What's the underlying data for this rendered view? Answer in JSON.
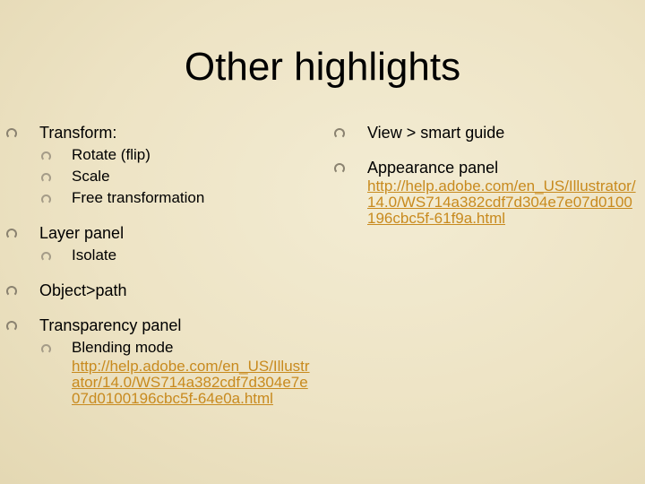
{
  "slide": {
    "title": "Other highlights",
    "link_color": "#c88a1e",
    "left_column": [
      {
        "label": "Transform:",
        "children": [
          {
            "label": "Rotate (flip)"
          },
          {
            "label": "Scale"
          },
          {
            "label": "Free transformation"
          }
        ]
      },
      {
        "label": "Layer panel",
        "children": [
          {
            "label": "Isolate"
          }
        ]
      },
      {
        "label": "Object>path"
      },
      {
        "label": "Transparency panel",
        "children": [
          {
            "label": "Blending mode",
            "link": "http://help.adobe.com/en_US/Illustrator/14.0/WS714a382cdf7d304e7e07d0100196cbc5f-64e0a.html"
          }
        ]
      }
    ],
    "right_column": [
      {
        "label": "View > smart guide"
      },
      {
        "label": "Appearance panel",
        "link": "http://help.adobe.com/en_US/Illustrator/14.0/WS714a382cdf7d304e7e07d0100196cbc5f-61f9a.html"
      }
    ]
  }
}
